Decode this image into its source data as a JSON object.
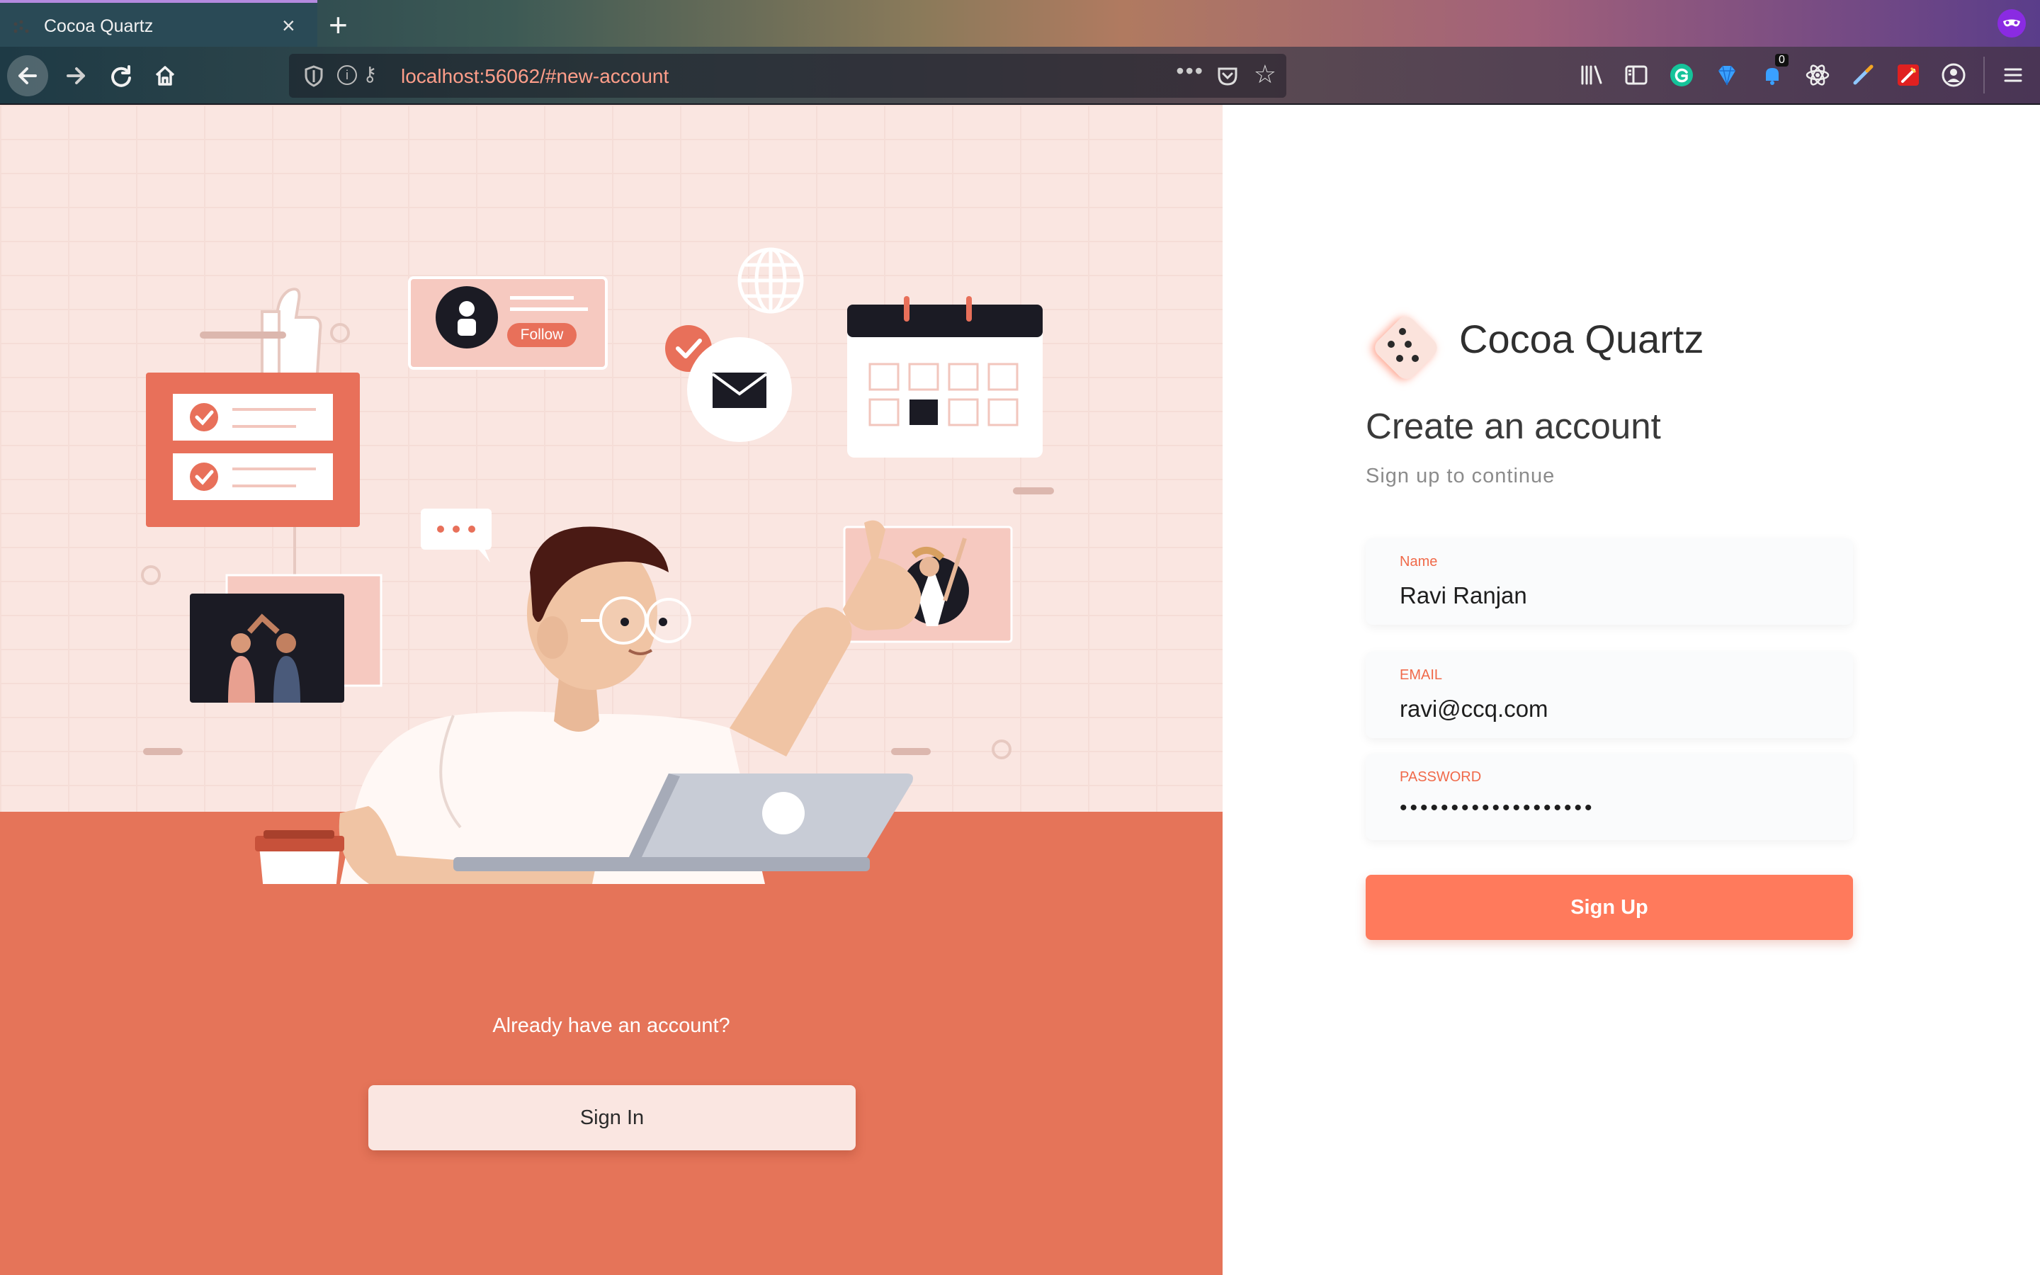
{
  "browser": {
    "tab_title": "Cocoa Quartz",
    "tab_close": "×",
    "new_tab": "+",
    "url": "localhost:56062/#new-account",
    "url_more": "•••",
    "toolbar_icons": [
      "library-icon",
      "sidebar-icon",
      "grammarly-icon",
      "gem-icon",
      "notification-icon",
      "react-devtools-icon",
      "eyedropper-icon",
      "colorzilla-icon",
      "account-icon",
      "menu-icon"
    ],
    "notification_count": "0"
  },
  "left_panel": {
    "follow_label": "Follow",
    "already_text": "Already have an account?",
    "signin_label": "Sign In"
  },
  "form": {
    "brand": "Cocoa Quartz",
    "heading": "Create an account",
    "subheading": "Sign up to continue",
    "name": {
      "label": "Name",
      "value": "Ravi Ranjan"
    },
    "email": {
      "label": "EMAIL",
      "value": "ravi@ccq.com"
    },
    "password": {
      "label": "PASSWORD",
      "value": "•••••••••••••••••••"
    },
    "signup_label": "Sign Up"
  },
  "colors": {
    "accent": "#ff7a5c",
    "floor": "#e57459",
    "wall": "#fae6e1",
    "label": "#f06a4a"
  }
}
